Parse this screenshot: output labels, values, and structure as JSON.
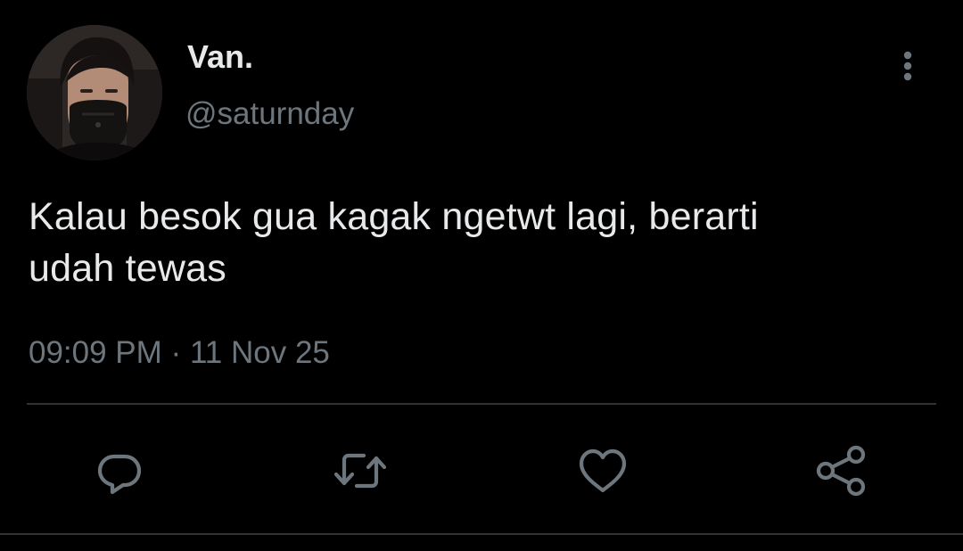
{
  "tweet": {
    "author": {
      "display_name": "Van.",
      "handle": "@saturnday"
    },
    "text_line1": "Kalau besok gua kagak ngetwt lagi, berarti",
    "text_line2": "udah tewas",
    "time": "09:09 PM",
    "separator": "·",
    "date": "11 Nov 25"
  },
  "icons": {
    "more": "more-vertical-icon",
    "reply": "reply-icon",
    "retweet": "retweet-icon",
    "like": "heart-icon",
    "share": "share-icon"
  },
  "colors": {
    "background": "#000000",
    "primary_text": "#e7e9ea",
    "secondary_text": "#6e767d",
    "divider": "#2f3336"
  }
}
